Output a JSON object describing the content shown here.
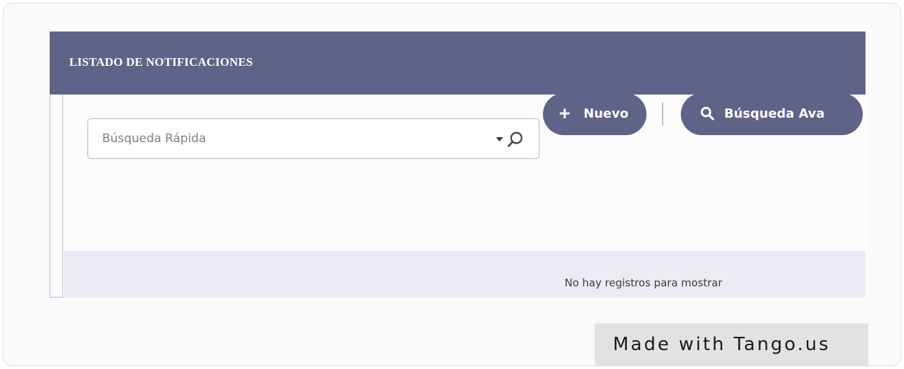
{
  "panel": {
    "title": "LISTADO DE NOTIFICACIONES"
  },
  "search": {
    "placeholder": "Búsqueda Rápida",
    "value": ""
  },
  "toolbar": {
    "new_label": "Nuevo",
    "advanced_search_label": "Búsqueda Ava"
  },
  "table": {
    "empty_message": "No hay registros para mostrar"
  },
  "watermark": {
    "text": "Made with Tango.us"
  },
  "icons": {
    "dropdown": "caret-down-icon",
    "search": "magnifier-icon",
    "new": "plus-icon",
    "advanced_search": "search-icon"
  },
  "colors": {
    "header_bg": "#5f6387",
    "button_bg": "#5f6387",
    "empty_row_bg": "#ebebf4",
    "border": "#b8b8d6",
    "watermark_bg": "#e2e2e2"
  }
}
